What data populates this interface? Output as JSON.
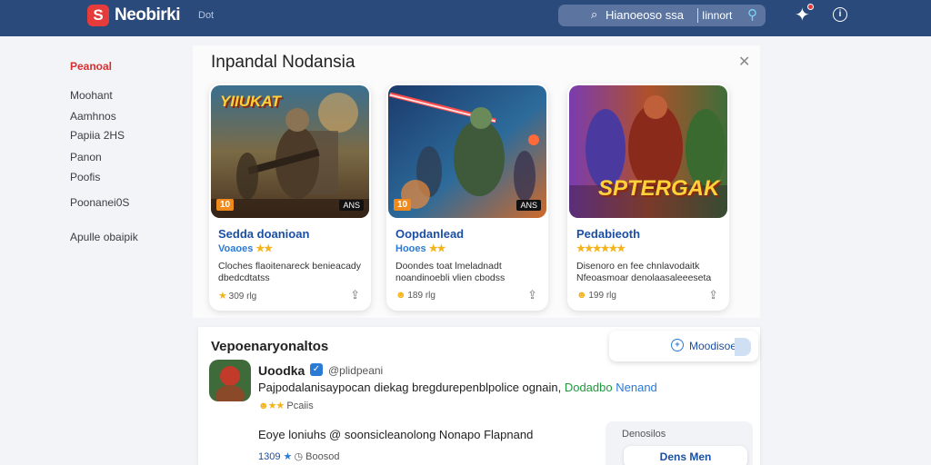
{
  "app": {
    "brand": "Neobirki",
    "brand_glyph": "S",
    "top_nav": "Dot",
    "search_text": "Hianoeoso ssa",
    "search_scope": "Iinnort"
  },
  "sidebar": {
    "items": [
      {
        "label": "Peanoal",
        "active": true
      },
      {
        "label": "Moohant"
      },
      {
        "label": "Aamhnos"
      },
      {
        "label": "Papiia 2HS"
      },
      {
        "label": "Panon"
      },
      {
        "label": "Poofis"
      },
      {
        "label": "Poonanei0S"
      },
      {
        "label": "Apulle obaipik"
      }
    ]
  },
  "featured": {
    "title": "Inpandal Nodansia",
    "cards": [
      {
        "logo": "YIIUKAT",
        "name": "Sedda doanioan",
        "sub": "Voaoes",
        "stars": "★★",
        "desc": "Cloches flaoitenareck benieacady dbedcdtatss",
        "foot": "309 rlg",
        "tag": "10",
        "rating_tag": "ANS"
      },
      {
        "logo": "",
        "name": "Oopdanlead",
        "sub": "Hooes",
        "stars": "★★",
        "desc": "Doondes toat lmeladnadt noandinoebli vlien cbodss",
        "foot": "189 rlg",
        "tag": "10",
        "rating_tag": "ANS"
      },
      {
        "logo": "SPTERGAK",
        "name": "Pedabieoth",
        "sub": "",
        "stars": "★★★★★★",
        "desc": "Disenoro en fee chnlavodaitk Nfeoasmoar denolaasaleeeseta",
        "foot": "199 rlg",
        "tag": "",
        "rating_tag": ""
      }
    ]
  },
  "reviews": {
    "title": "Vepoenaryonaltos",
    "button_label": "Moodisoe",
    "items": [
      {
        "name": "Uoodka",
        "handle": "@plidpeani",
        "text": "Pajpodalanisaypocan diekag bregdurepenblpolice ognain,",
        "link1": "Dodadbo",
        "link2": "Nenand",
        "meta": "Pcaiis"
      }
    ],
    "second_text": "Eoye loniuhs @ soonsicleanolong Nonapo Flapnand",
    "second_meta_count": "1309",
    "second_meta_label": "Boosod",
    "sidebox_label": "Denosilos",
    "sidebox_button": "Dens Men"
  },
  "colors": {
    "topbar": "#2b4a7c",
    "accent_red": "#e63b3b",
    "link_blue": "#1a4fa3",
    "star_yellow": "#f3b41b"
  },
  "icons": [
    "logo-icon",
    "search-icon",
    "pin-icon",
    "notification-icon",
    "info-icon",
    "close-icon",
    "share-icon",
    "verified-icon",
    "star-icon"
  ]
}
